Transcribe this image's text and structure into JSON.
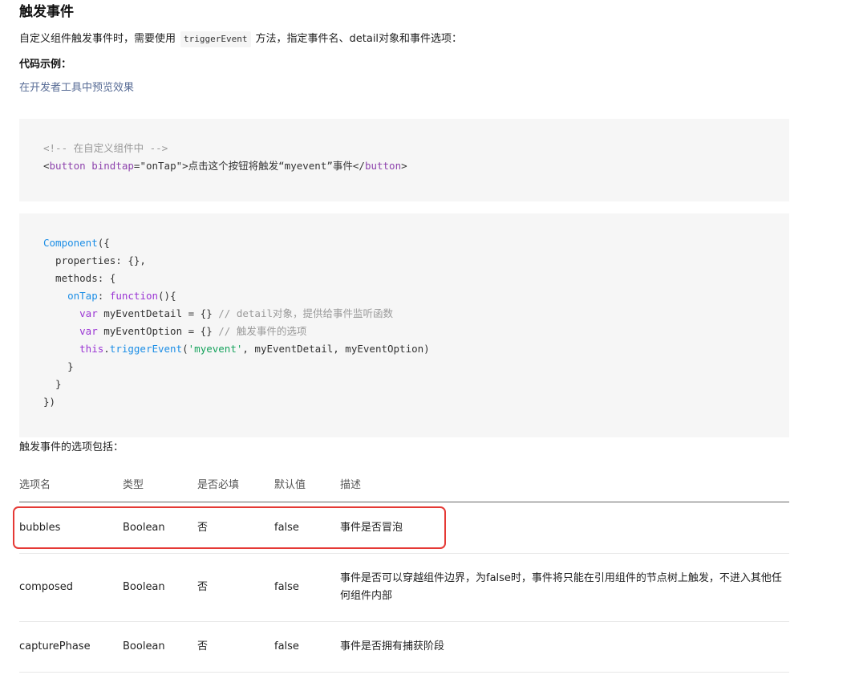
{
  "section": {
    "title": "触发事件",
    "intro_before": "自定义组件触发事件时，需要使用",
    "inline_code": "triggerEvent",
    "intro_after": "方法，指定事件名、detail对象和事件选项：",
    "example_label": "代码示例：",
    "preview_link": "在开发者工具中预览效果",
    "options_heading": "触发事件的选项包括："
  },
  "code_wxml": {
    "comment": "<!-- 在自定义组件中 -->",
    "line2": {
      "open_lt": "<",
      "tag": "button",
      "attr": "bindtap",
      "eq": "=",
      "attr_value": "\"onTap\"",
      "gt": ">",
      "text": "点击这个按钮将触发“myevent”事件",
      "close_lt": "</",
      "close_tag": "button",
      "close_gt": ">"
    }
  },
  "code_js": {
    "l1_component": "Component",
    "l1_rest": "({",
    "l2": "  properties: {},",
    "l3": "  methods: {",
    "l4_indent": "    ",
    "l4_name": "onTap",
    "l4_colon": ": ",
    "l4_function": "function",
    "l4_rest": "(){",
    "l5_indent": "      ",
    "l5_var": "var",
    "l5_name": " myEventDetail = {}",
    "l5_comment": " // detail对象，提供给事件监听函数",
    "l6_indent": "      ",
    "l6_var": "var",
    "l6_name": " myEventOption = {}",
    "l6_comment": " // 触发事件的选项",
    "l7_indent": "      ",
    "l7_this": "this",
    "l7_dot": ".",
    "l7_method": "triggerEvent",
    "l7_open": "(",
    "l7_string": "'myevent'",
    "l7_rest": ", myEventDetail, myEventOption)",
    "l8": "    }",
    "l9": "  }",
    "l10": "})"
  },
  "table": {
    "headers": [
      "选项名",
      "类型",
      "是否必填",
      "默认值",
      "描述"
    ],
    "rows": [
      [
        "bubbles",
        "Boolean",
        "否",
        "false",
        "事件是否冒泡"
      ],
      [
        "composed",
        "Boolean",
        "否",
        "false",
        "事件是否可以穿越组件边界，为false时，事件将只能在引用组件的节点树上触发，不进入其他任何组件内部"
      ],
      [
        "capturePhase",
        "Boolean",
        "否",
        "false",
        "事件是否拥有捕获阶段"
      ]
    ]
  },
  "colors": {
    "link": "#576b95",
    "highlight": "#e53935",
    "code_background": "#f6f6f6"
  }
}
